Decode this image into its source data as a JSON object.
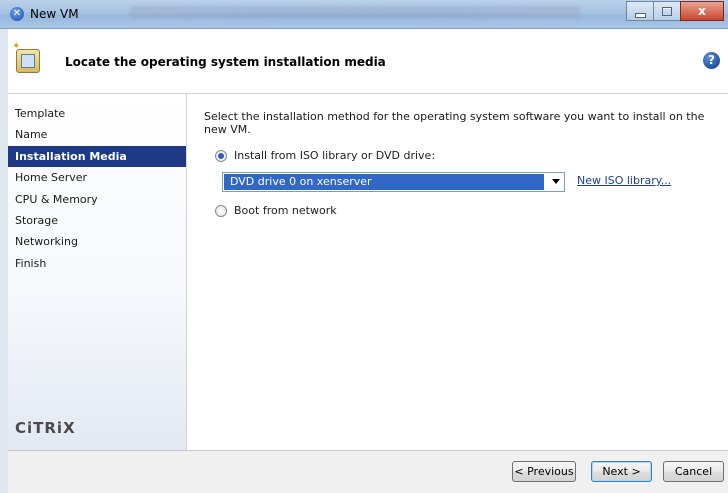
{
  "window": {
    "title": "New VM",
    "controls": {
      "close": "x"
    }
  },
  "header": {
    "title": "Locate the operating system installation media",
    "help": "?"
  },
  "sidebar": {
    "items": [
      {
        "label": "Template"
      },
      {
        "label": "Name"
      },
      {
        "label": "Installation Media",
        "active": true
      },
      {
        "label": "Home Server"
      },
      {
        "label": "CPU & Memory"
      },
      {
        "label": "Storage"
      },
      {
        "label": "Networking"
      },
      {
        "label": "Finish"
      }
    ],
    "logo": "CiTRiX"
  },
  "main": {
    "instruction": "Select the installation method for the operating system software you want to install on the new VM.",
    "option_iso": {
      "label": "Install from ISO library or DVD drive:",
      "checked": true
    },
    "drive_select": {
      "value": "DVD drive 0 on xenserver"
    },
    "new_iso_link": "New ISO library...",
    "option_network": {
      "label": "Boot from network",
      "checked": false
    }
  },
  "footer": {
    "previous": "< Previous",
    "next": "Next >",
    "cancel": "Cancel"
  },
  "colors": {
    "selection_blue": "#1e3a87",
    "select_highlight": "#3167c6",
    "link_blue": "#1e3ea3"
  }
}
